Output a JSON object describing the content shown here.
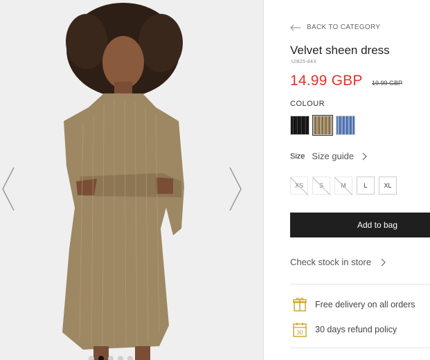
{
  "gallery": {
    "image_alt": "Model wearing gold velvet sheen dress",
    "dots": [
      false,
      true,
      false,
      false,
      false
    ]
  },
  "product": {
    "back_label": "BACK TO CATEGORY",
    "title": "Velvet sheen dress",
    "sku": "UI825-84X",
    "price": "14.99 GBP",
    "old_price": "19.99 GBP",
    "colour_label": "COLOUR",
    "colours": [
      "black",
      "gold",
      "blue"
    ],
    "selected_colour": "gold",
    "size_label": "Size",
    "size_guide": "Size guide",
    "sizes": [
      {
        "label": "XS",
        "available": false
      },
      {
        "label": "S",
        "available": false
      },
      {
        "label": "M",
        "available": false
      },
      {
        "label": "L",
        "available": true
      },
      {
        "label": "XL",
        "available": true
      }
    ],
    "add_to_bag": "Add to bag",
    "check_stock": "Check stock in store"
  },
  "features": {
    "delivery": "Free delivery on all orders",
    "refund": "30 days refund policy",
    "refund_days_icon": "30"
  },
  "colors": {
    "price_red": "#e4322b",
    "accent_gold": "#c9a227",
    "button_dark": "#1f1f1f"
  }
}
